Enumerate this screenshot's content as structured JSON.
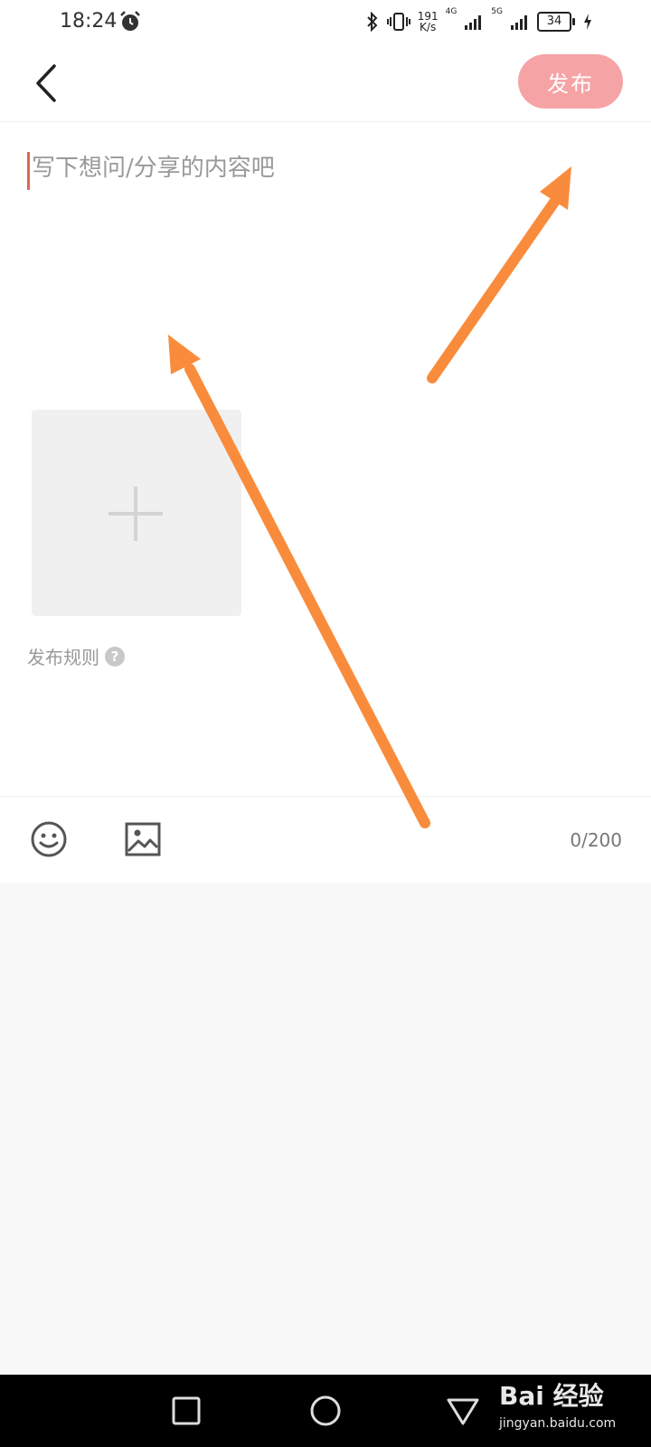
{
  "status_bar": {
    "time": "18:24",
    "net_speed_value": "191",
    "net_speed_unit": "K/s",
    "signal_1": "4G",
    "signal_2": "5G",
    "battery": "34"
  },
  "header": {
    "publish_label": "发布"
  },
  "editor": {
    "placeholder": "写下想问/分享的内容吧",
    "value": ""
  },
  "rules": {
    "label": "发布规则",
    "help_glyph": "?"
  },
  "toolbar": {
    "counter": "0/200"
  },
  "watermark": {
    "brand": "Bai 经验",
    "url": "jingyan.baidu.com"
  },
  "colors": {
    "publish_button": "#f6a3a6",
    "annotation_arrow": "#f98c3c",
    "caret": "#e06655"
  },
  "icons": [
    "alarm-icon",
    "bluetooth-icon",
    "vibrate-icon",
    "signal-icon",
    "battery-icon",
    "charging-icon",
    "back-arrow-icon",
    "plus-icon",
    "help-icon",
    "emoji-icon",
    "image-icon",
    "recents-icon",
    "home-icon",
    "back-nav-icon"
  ]
}
